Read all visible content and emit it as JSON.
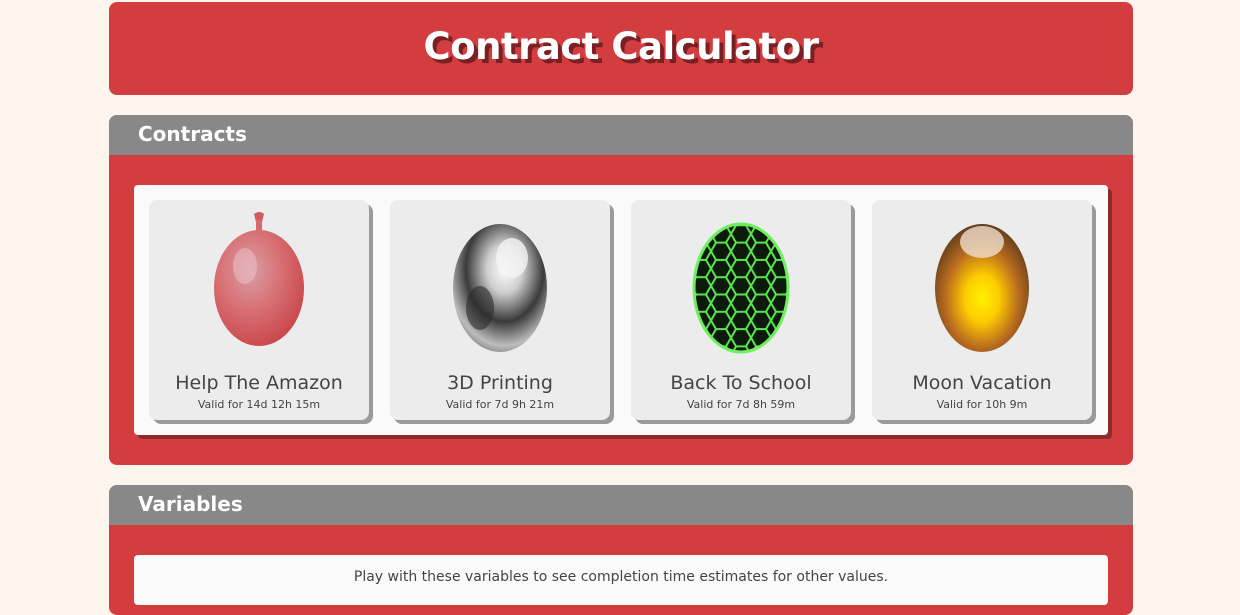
{
  "header": {
    "title": "Contract Calculator"
  },
  "contracts": {
    "heading": "Contracts",
    "cards": [
      {
        "name": "Help The Amazon",
        "valid": "Valid for 14d 12h 15m",
        "icon": "red-balloon-egg-icon"
      },
      {
        "name": "3D Printing",
        "valid": "Valid for 7d 9h 21m",
        "icon": "chrome-egg-icon"
      },
      {
        "name": "Back To School",
        "valid": "Valid for 7d 8h 59m",
        "icon": "green-hex-egg-icon"
      },
      {
        "name": "Moon Vacation",
        "valid": "Valid for 10h 9m",
        "icon": "golden-egg-icon"
      }
    ]
  },
  "variables": {
    "heading": "Variables",
    "hint": "Play with these variables to see completion time estimates for other values."
  },
  "colors": {
    "accent": "#d43d3f",
    "section_header": "#888888",
    "background": "#fdf4ee"
  }
}
